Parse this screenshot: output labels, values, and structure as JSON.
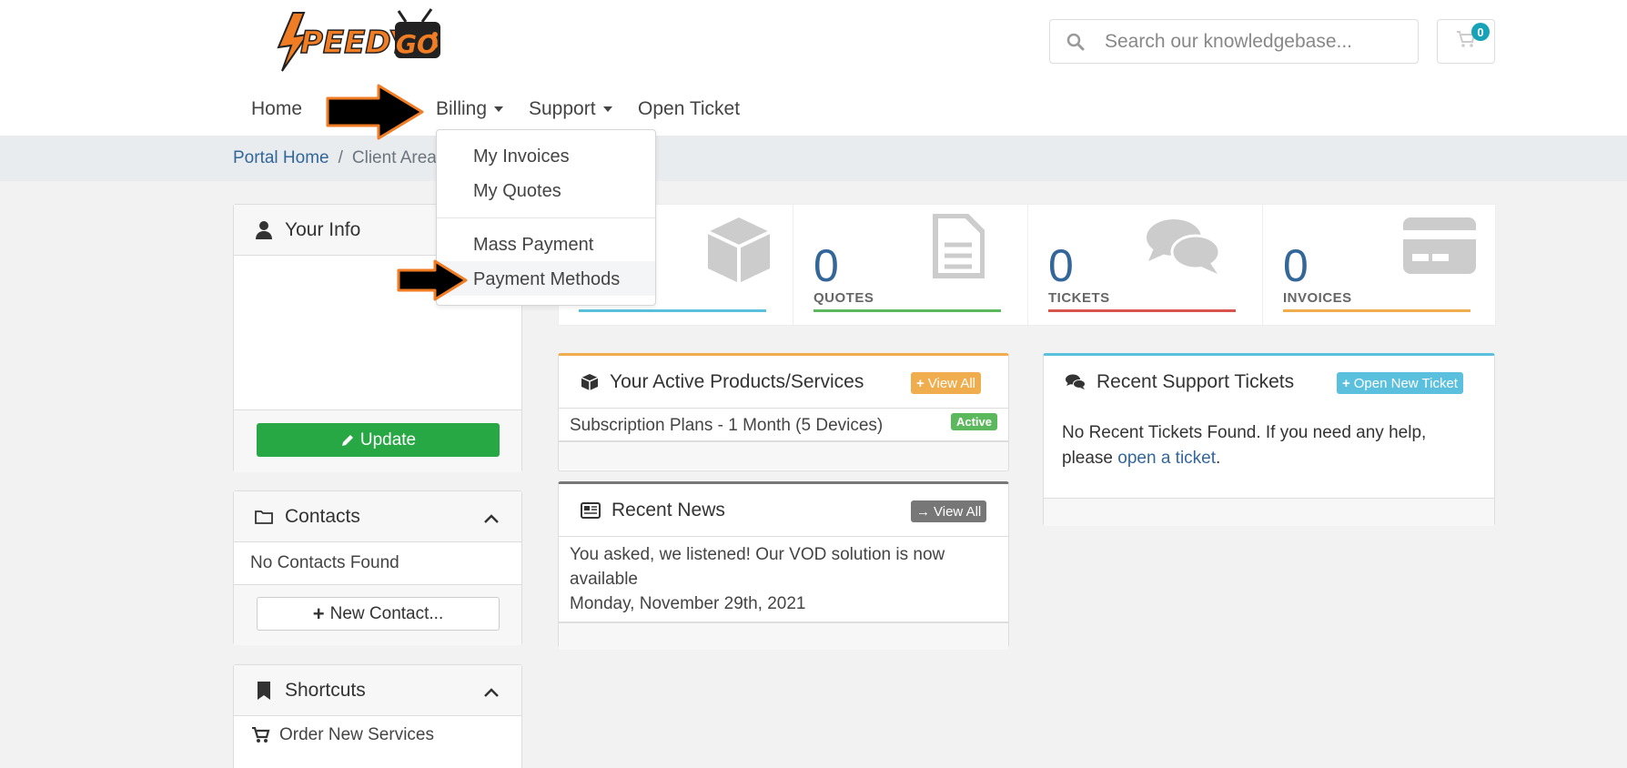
{
  "brand": {
    "logo_text": "SPEEDYGO",
    "accent": "#f07c23"
  },
  "search": {
    "placeholder": "Search our knowledgebase..."
  },
  "cart": {
    "count": "0"
  },
  "nav": {
    "home": "Home",
    "billing": "Billing",
    "support": "Support",
    "open_ticket": "Open Ticket"
  },
  "billing_menu": {
    "items": [
      "My Invoices",
      "My Quotes",
      "Mass Payment",
      "Payment Methods"
    ]
  },
  "breadcrumb": {
    "home": "Portal Home",
    "current": "Client Area"
  },
  "sidebar": {
    "your_info": {
      "title": "Your Info",
      "update_label": "Update"
    },
    "contacts": {
      "title": "Contacts",
      "empty": "No Contacts Found",
      "new_label": "New Contact..."
    },
    "shortcuts": {
      "title": "Shortcuts",
      "items": [
        "Order New Services"
      ]
    }
  },
  "stats": [
    {
      "value": "0",
      "label": "QUOTES",
      "color": "#5cb85c"
    },
    {
      "value": "0",
      "label": "TICKETS",
      "color": "#d9534f"
    },
    {
      "value": "0",
      "label": "INVOICES",
      "color": "#f0ad4e"
    }
  ],
  "products": {
    "title": "Your Active Products/Services",
    "view_all": "View All",
    "item": "Subscription Plans - 1 Month (5 Devices)",
    "status": "Active"
  },
  "news": {
    "title": "Recent News",
    "view_all": "View All",
    "headline": "You asked, we listened! Our VOD solution is now available",
    "date": "Monday, November 29th, 2021"
  },
  "tickets": {
    "title": "Recent Support Tickets",
    "open_new": "Open New Ticket",
    "text": "No Recent Tickets Found. If you need any help, please",
    "link": "open a ticket",
    "end": "."
  },
  "colors": {
    "primary_link": "#336699",
    "info": "#5bc0de",
    "success": "#28a745",
    "warning": "#f0ad4e"
  }
}
